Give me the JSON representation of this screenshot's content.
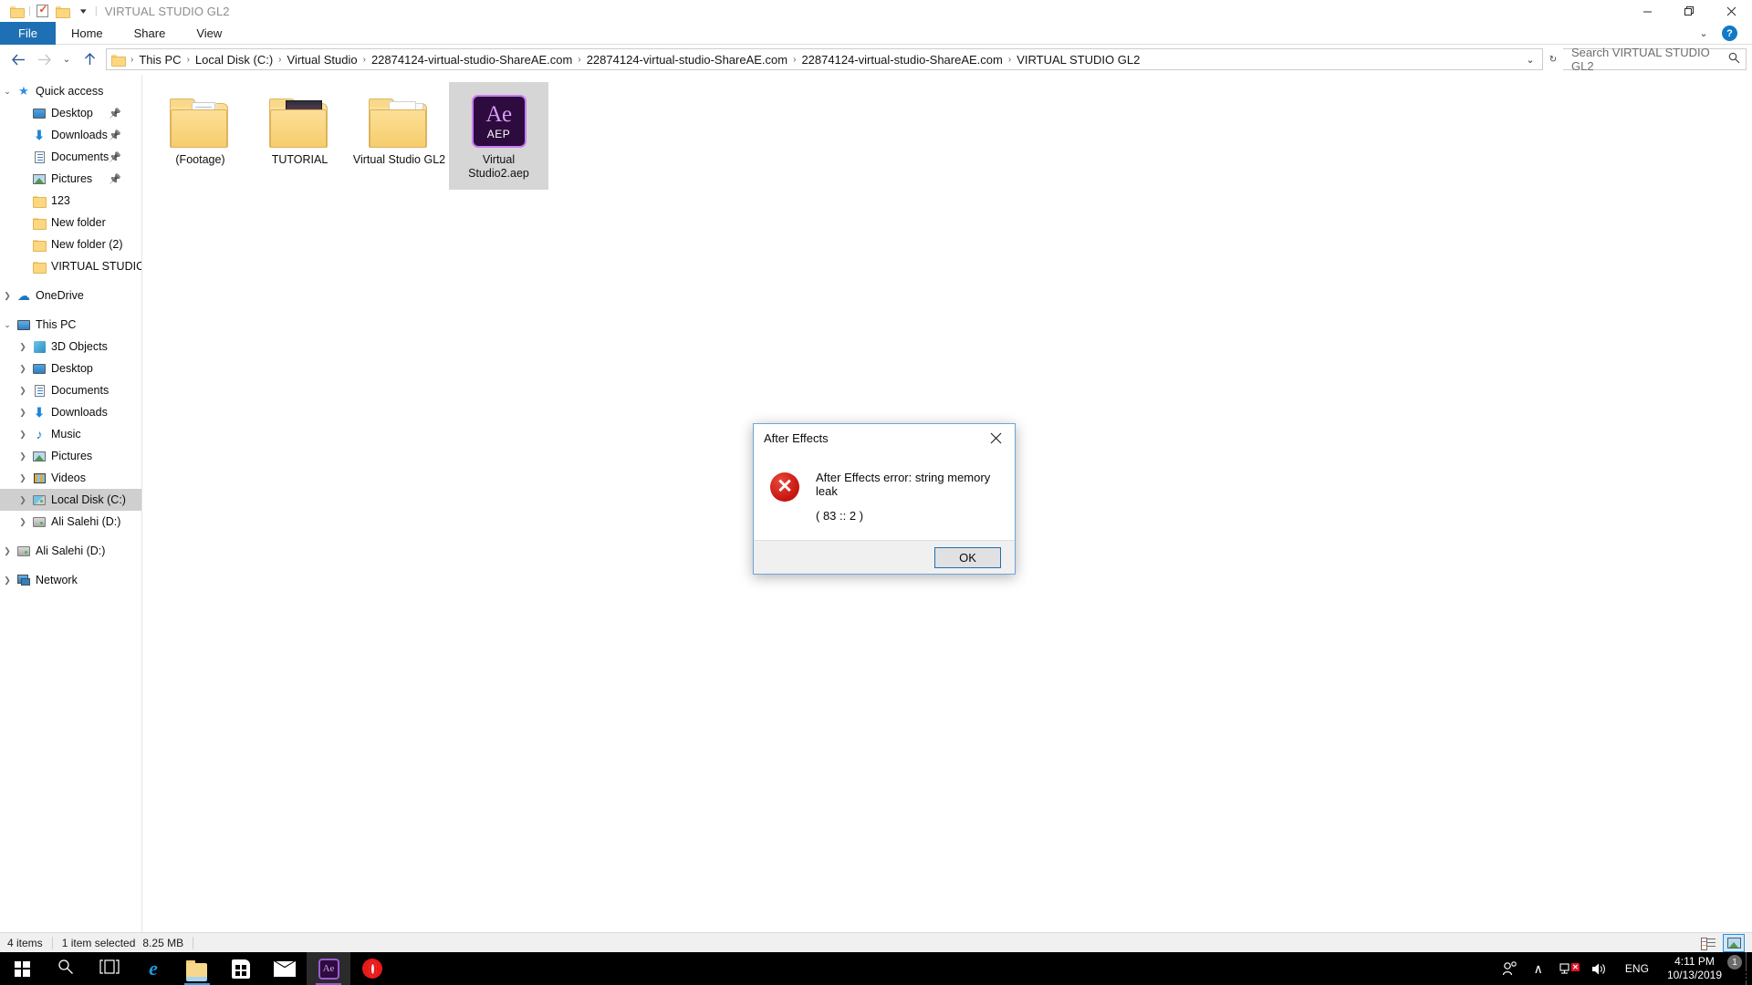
{
  "window": {
    "title": "VIRTUAL STUDIO GL2",
    "quick_access_icons": [
      "folder-icon",
      "properties-icon",
      "new-folder-icon",
      "customize-qat-chevron-icon"
    ],
    "minimize_label": "—",
    "maximize_label": "❐",
    "close_label": "✕"
  },
  "ribbon": {
    "tabs": [
      {
        "label": "File",
        "active": true
      },
      {
        "label": "Home",
        "active": false
      },
      {
        "label": "Share",
        "active": false
      },
      {
        "label": "View",
        "active": false
      }
    ],
    "expand_chevron": "⌄",
    "help_label": "?"
  },
  "addressbar": {
    "back_label": "←",
    "forward_label": "→",
    "recent_label": "⌄",
    "up_label": "↑",
    "crumb_separator": "›",
    "crumbs": [
      "This PC",
      "Local Disk (C:)",
      "Virtual Studio",
      "22874124-virtual-studio-ShareAE.com",
      "22874124-virtual-studio-ShareAE.com",
      "22874124-virtual-studio-ShareAE.com",
      "VIRTUAL STUDIO GL2"
    ],
    "history_chevron": "⌄",
    "refresh_label": "↻",
    "search_placeholder": "Search VIRTUAL STUDIO GL2",
    "search_value": "",
    "search_icon": "search-icon"
  },
  "sidebar": {
    "items": [
      {
        "label": "Quick access",
        "level": 1,
        "chev": "open",
        "icon": "star-icon",
        "pinned": false,
        "selected": false
      },
      {
        "label": "Desktop",
        "level": 2,
        "chev": "none",
        "icon": "desktop-icon",
        "pinned": true,
        "selected": false
      },
      {
        "label": "Downloads",
        "level": 2,
        "chev": "none",
        "icon": "download-icon",
        "pinned": true,
        "selected": false
      },
      {
        "label": "Documents",
        "level": 2,
        "chev": "none",
        "icon": "documents-icon",
        "pinned": true,
        "selected": false
      },
      {
        "label": "Pictures",
        "level": 2,
        "chev": "none",
        "icon": "pictures-icon",
        "pinned": true,
        "selected": false
      },
      {
        "label": "123",
        "level": 2,
        "chev": "none",
        "icon": "folder-icon",
        "pinned": false,
        "selected": false
      },
      {
        "label": "New folder",
        "level": 2,
        "chev": "none",
        "icon": "folder-icon",
        "pinned": false,
        "selected": false
      },
      {
        "label": "New folder (2)",
        "level": 2,
        "chev": "none",
        "icon": "folder-icon",
        "pinned": false,
        "selected": false
      },
      {
        "label": "VIRTUAL STUDIO Gl",
        "level": 2,
        "chev": "none",
        "icon": "folder-icon",
        "pinned": false,
        "selected": false
      },
      {
        "label": "OneDrive",
        "level": 1,
        "chev": "closed",
        "icon": "cloud-icon",
        "pinned": false,
        "selected": false
      },
      {
        "label": "This PC",
        "level": 1,
        "chev": "open",
        "icon": "pc-icon",
        "pinned": false,
        "selected": false
      },
      {
        "label": "3D Objects",
        "level": 3,
        "chev": "closed",
        "icon": "3d-objects-icon",
        "pinned": false,
        "selected": false
      },
      {
        "label": "Desktop",
        "level": 3,
        "chev": "closed",
        "icon": "desktop-icon",
        "pinned": false,
        "selected": false
      },
      {
        "label": "Documents",
        "level": 3,
        "chev": "closed",
        "icon": "documents-icon",
        "pinned": false,
        "selected": false
      },
      {
        "label": "Downloads",
        "level": 3,
        "chev": "closed",
        "icon": "download-icon",
        "pinned": false,
        "selected": false
      },
      {
        "label": "Music",
        "level": 3,
        "chev": "closed",
        "icon": "music-icon",
        "pinned": false,
        "selected": false
      },
      {
        "label": "Pictures",
        "level": 3,
        "chev": "closed",
        "icon": "pictures-icon",
        "pinned": false,
        "selected": false
      },
      {
        "label": "Videos",
        "level": 3,
        "chev": "closed",
        "icon": "videos-icon",
        "pinned": false,
        "selected": false
      },
      {
        "label": "Local Disk (C:)",
        "level": 3,
        "chev": "closed",
        "icon": "system-disk-icon",
        "pinned": false,
        "selected": true
      },
      {
        "label": "Ali Salehi (D:)",
        "level": 3,
        "chev": "closed",
        "icon": "disk-icon",
        "pinned": false,
        "selected": false
      },
      {
        "label": "Ali Salehi (D:)",
        "level": 1,
        "chev": "closed",
        "icon": "disk-icon",
        "pinned": false,
        "selected": false
      },
      {
        "label": "Network",
        "level": 1,
        "chev": "closed",
        "icon": "network-icon",
        "pinned": false,
        "selected": false
      }
    ]
  },
  "files": [
    {
      "name": "(Footage)",
      "kind": "folder-with-image",
      "selected": false
    },
    {
      "name": "TUTORIAL",
      "kind": "folder-with-photo",
      "selected": false
    },
    {
      "name": "Virtual Studio GL2",
      "kind": "folder-with-docs",
      "selected": false
    },
    {
      "name": "Virtual Studio2.aep",
      "kind": "aep-file",
      "badge": "Ae",
      "ext": "AEP",
      "selected": true
    }
  ],
  "statusbar": {
    "item_count": "4 items",
    "selection": "1 item selected",
    "size": "8.25 MB",
    "details_view_icon": "details-view-icon",
    "large_icons_view_icon": "large-icons-view-icon"
  },
  "dialog": {
    "title": "After Effects",
    "close_label": "✕",
    "error_icon": "error-x-icon",
    "message_line1": "After Effects error: string memory leak",
    "message_line2": "( 83 :: 2 )",
    "ok_label": "OK"
  },
  "taskbar": {
    "items": [
      {
        "name": "start-button",
        "icon": "windows-logo-icon"
      },
      {
        "name": "search-button",
        "icon": "search-icon"
      },
      {
        "name": "task-view-button",
        "icon": "task-view-icon"
      },
      {
        "name": "edge-button",
        "icon": "edge-icon"
      },
      {
        "name": "file-explorer-button",
        "icon": "file-explorer-icon"
      },
      {
        "name": "microsoft-store-button",
        "icon": "store-icon"
      },
      {
        "name": "mail-button",
        "icon": "mail-icon"
      },
      {
        "name": "after-effects-button",
        "icon": "after-effects-icon"
      },
      {
        "name": "opera-button",
        "icon": "opera-icon"
      }
    ],
    "tray": {
      "people_icon": "people-icon",
      "overflow_chevron": "∧",
      "network_icon": "network-disconnected-icon",
      "volume_icon": "🔊",
      "language": "ENG",
      "time": "4:11 PM",
      "date": "10/13/2019",
      "action_center_icon": "action-center-icon",
      "notification_count": "1"
    }
  },
  "colors": {
    "accent": "#1f6fb5",
    "selection": "#d6d6d6",
    "error_red": "#c5140e",
    "taskbar_bg": "#000000",
    "aep_purple": "#c77df0"
  }
}
